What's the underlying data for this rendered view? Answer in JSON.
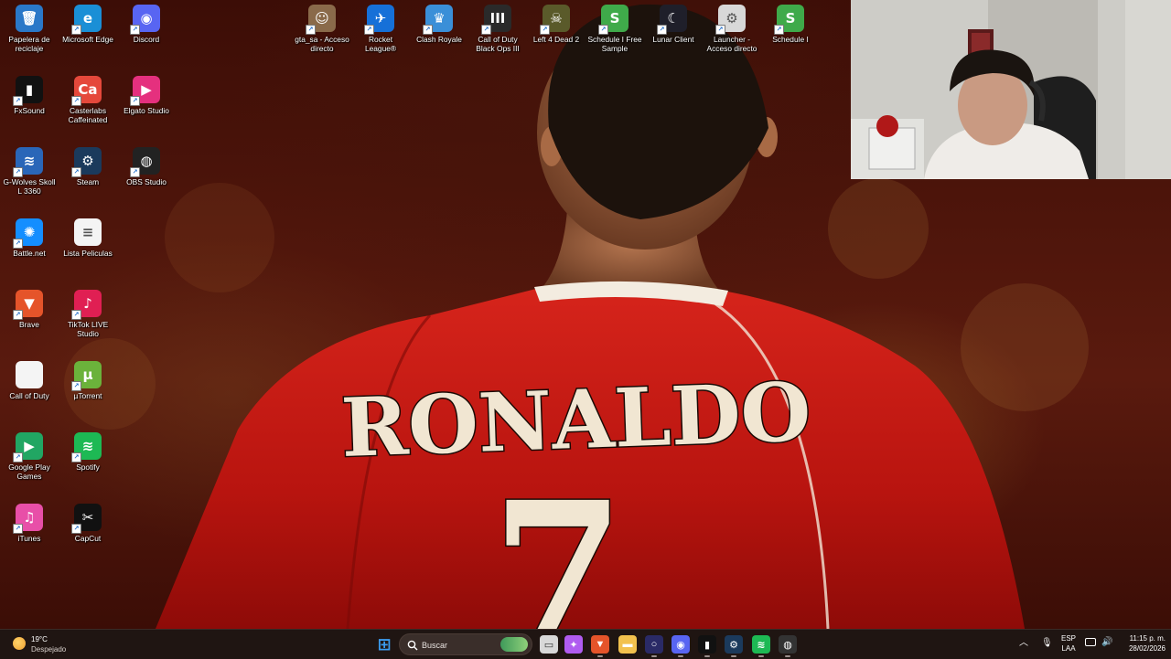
{
  "desktop_icons": [
    {
      "label": "Papelera de reciclaje",
      "icon": "recycle-bin-icon",
      "glyph": "🗑",
      "color": "#2a78c8",
      "shortcut": false
    },
    {
      "label": "Microsoft Edge",
      "icon": "edge-icon",
      "glyph": "e",
      "color": "#1a8fd6",
      "shortcut": true
    },
    {
      "label": "Discord",
      "icon": "discord-icon",
      "glyph": "◉",
      "color": "#5865f2",
      "shortcut": true
    },
    {
      "label": "FxSound",
      "icon": "fxsound-icon",
      "glyph": "▮",
      "color": "#111111",
      "shortcut": true
    },
    {
      "label": "Casterlabs Caffeinated",
      "icon": "casterlabs-icon",
      "glyph": "Ca",
      "color": "#e5483b",
      "shortcut": true
    },
    {
      "label": "Elgato Studio",
      "icon": "elgato-studio-icon",
      "glyph": "▶",
      "color": "#e5307e",
      "shortcut": true
    },
    {
      "label": "G-Wolves Skoll L 3360",
      "icon": "gwolves-icon",
      "glyph": "≋",
      "color": "#2a66b8",
      "shortcut": true
    },
    {
      "label": "Steam",
      "icon": "steam-icon",
      "glyph": "⚙",
      "color": "#1b3a5c",
      "shortcut": true
    },
    {
      "label": "OBS Studio",
      "icon": "obs-studio-icon",
      "glyph": "◍",
      "color": "#222222",
      "shortcut": true
    },
    {
      "label": "Battle.net",
      "icon": "battlenet-icon",
      "glyph": "✺",
      "color": "#148eff",
      "shortcut": true
    },
    {
      "label": "Lista Peliculas",
      "icon": "text-file-icon",
      "glyph": "≡",
      "color": "#f4f4f4",
      "shortcut": false
    },
    {
      "label": "Brave",
      "icon": "brave-icon",
      "glyph": "▼",
      "color": "#e5542a",
      "shortcut": true
    },
    {
      "label": "TikTok LIVE Studio",
      "icon": "tiktok-live-icon",
      "glyph": "♪",
      "color": "#e01f53",
      "shortcut": true
    },
    {
      "label": "Call of Duty",
      "icon": "blank-file-icon",
      "glyph": "",
      "color": "#f4f4f4",
      "shortcut": false
    },
    {
      "label": "µTorrent",
      "icon": "utorrent-icon",
      "glyph": "µ",
      "color": "#6bb23b",
      "shortcut": true
    },
    {
      "label": "Google Play Games",
      "icon": "google-play-games-icon",
      "glyph": "▶",
      "color": "#21a663",
      "shortcut": true
    },
    {
      "label": "Spotify",
      "icon": "spotify-icon",
      "glyph": "≋",
      "color": "#1db954",
      "shortcut": true
    },
    {
      "label": "iTunes",
      "icon": "itunes-icon",
      "glyph": "♫",
      "color": "#e84fa8",
      "shortcut": true
    },
    {
      "label": "CapCut",
      "icon": "capcut-icon",
      "glyph": "✂",
      "color": "#111111",
      "shortcut": true
    },
    {
      "label": "gta_sa - Acceso directo",
      "icon": "gta-sa-icon",
      "glyph": "☺",
      "color": "#8a6a4a",
      "shortcut": true
    },
    {
      "label": "Rocket League®",
      "icon": "rocket-league-icon",
      "glyph": "✈",
      "color": "#1670d8",
      "shortcut": true
    },
    {
      "label": "Clash Royale",
      "icon": "clash-royale-icon",
      "glyph": "♛",
      "color": "#3a8fd8",
      "shortcut": true
    },
    {
      "label": "Call of Duty Black Ops III",
      "icon": "cod-bo3-icon",
      "glyph": "III",
      "color": "#2a2a2a",
      "shortcut": true
    },
    {
      "label": "Left 4 Dead 2",
      "icon": "left4dead2-icon",
      "glyph": "☠",
      "color": "#5a5a2a",
      "shortcut": true
    },
    {
      "label": "Schedule I Free Sample",
      "icon": "schedule-i-icon",
      "glyph": "S",
      "color": "#3faa4a",
      "shortcut": true
    },
    {
      "label": "Lunar Client",
      "icon": "lunar-client-icon",
      "glyph": "☾",
      "color": "#1f1f2a",
      "shortcut": true
    },
    {
      "label": "Launcher - Acceso directo",
      "icon": "launcher-icon",
      "glyph": "⚙",
      "color": "#d8d8d8",
      "shortcut": true
    },
    {
      "label": "Schedule I",
      "icon": "schedule-i-icon",
      "glyph": "S",
      "color": "#3faa4a",
      "shortcut": true
    }
  ],
  "wallpaper": {
    "name_text": "RONALDO",
    "number_text": "7"
  },
  "taskbar": {
    "weather": {
      "temp": "19°C",
      "condition": "Despejado"
    },
    "search_placeholder": "Buscar",
    "apps": [
      {
        "name": "start",
        "icon": "windows-start-icon",
        "glyph": "⊞",
        "color": "#3b9cf0",
        "running": false
      },
      {
        "name": "search",
        "icon": "search-icon",
        "glyph": "",
        "color": "",
        "running": false
      },
      {
        "name": "task-view",
        "icon": "task-view-icon",
        "glyph": "▭",
        "color": "#d8d8d8",
        "running": false
      },
      {
        "name": "copilot",
        "icon": "copilot-icon",
        "glyph": "✦",
        "color": "#b05cf0",
        "running": false
      },
      {
        "name": "brave",
        "icon": "brave-icon",
        "glyph": "▼",
        "color": "#e5542a",
        "running": true
      },
      {
        "name": "file-explorer",
        "icon": "folder-icon",
        "glyph": "▬",
        "color": "#f2c14e",
        "running": false
      },
      {
        "name": "cortana",
        "icon": "circle-app-icon",
        "glyph": "○",
        "color": "#2a2a66",
        "running": true
      },
      {
        "name": "discord",
        "icon": "discord-icon",
        "glyph": "◉",
        "color": "#5865f2",
        "running": true
      },
      {
        "name": "fxsound",
        "icon": "fxsound-icon",
        "glyph": "▮",
        "color": "#111111",
        "running": true
      },
      {
        "name": "steam",
        "icon": "steam-icon",
        "glyph": "⚙",
        "color": "#1b3a5c",
        "running": true
      },
      {
        "name": "spotify",
        "icon": "spotify-icon",
        "glyph": "≋",
        "color": "#1db954",
        "running": true
      },
      {
        "name": "obs",
        "icon": "obs-studio-icon",
        "glyph": "◍",
        "color": "#333333",
        "running": true
      }
    ],
    "tray": {
      "lang_line1": "ESP",
      "lang_line2": "LAA",
      "time": "11:15 p. m.",
      "date": "28/02/2026"
    }
  }
}
